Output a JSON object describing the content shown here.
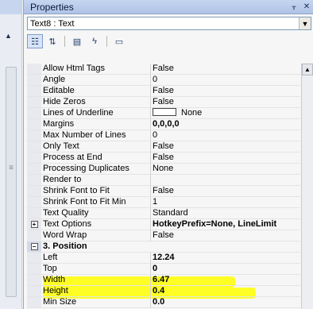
{
  "panel": {
    "title": "Properties",
    "pin_icon": "pin-icon",
    "close_icon": "close-icon",
    "object_selector": "Text8 : Text"
  },
  "toolbar": {
    "buttons": [
      "categorized-icon",
      "alphabetical-icon",
      "properties-icon",
      "events-icon",
      "property-pages-icon"
    ]
  },
  "properties": [
    {
      "name": "Allow Html Tags",
      "value": "False"
    },
    {
      "name": "Angle",
      "value": "0"
    },
    {
      "name": "Editable",
      "value": "False"
    },
    {
      "name": "Hide Zeros",
      "value": "False"
    },
    {
      "name": "Lines of Underline",
      "value": "None"
    },
    {
      "name": "Margins",
      "value": "0,0,0,0"
    },
    {
      "name": "Max Number of Lines",
      "value": "0"
    },
    {
      "name": "Only Text",
      "value": "False"
    },
    {
      "name": "Process at End",
      "value": "False"
    },
    {
      "name": "Processing Duplicates",
      "value": "None"
    },
    {
      "name": "Render to",
      "value": ""
    },
    {
      "name": "Shrink Font to Fit",
      "value": "False"
    },
    {
      "name": "Shrink Font to Fit Min",
      "value": "1"
    },
    {
      "name": "Text Quality",
      "value": "Standard"
    },
    {
      "name": "Text Options",
      "value": "HotkeyPrefix=None, LineLimit"
    },
    {
      "name": "Word Wrap",
      "value": "False"
    }
  ],
  "position_category": {
    "label": "3. Position",
    "items": [
      {
        "name": "Left",
        "value": "12.24"
      },
      {
        "name": "Top",
        "value": "0"
      },
      {
        "name": "Width",
        "value": "6.47"
      },
      {
        "name": "Height",
        "value": "0.4"
      },
      {
        "name": "Min Size",
        "value": "0.0"
      }
    ]
  },
  "colors": {
    "highlight": "#ffff00",
    "titlebar": "#c5d6f1",
    "category": "#d4dbe8"
  }
}
